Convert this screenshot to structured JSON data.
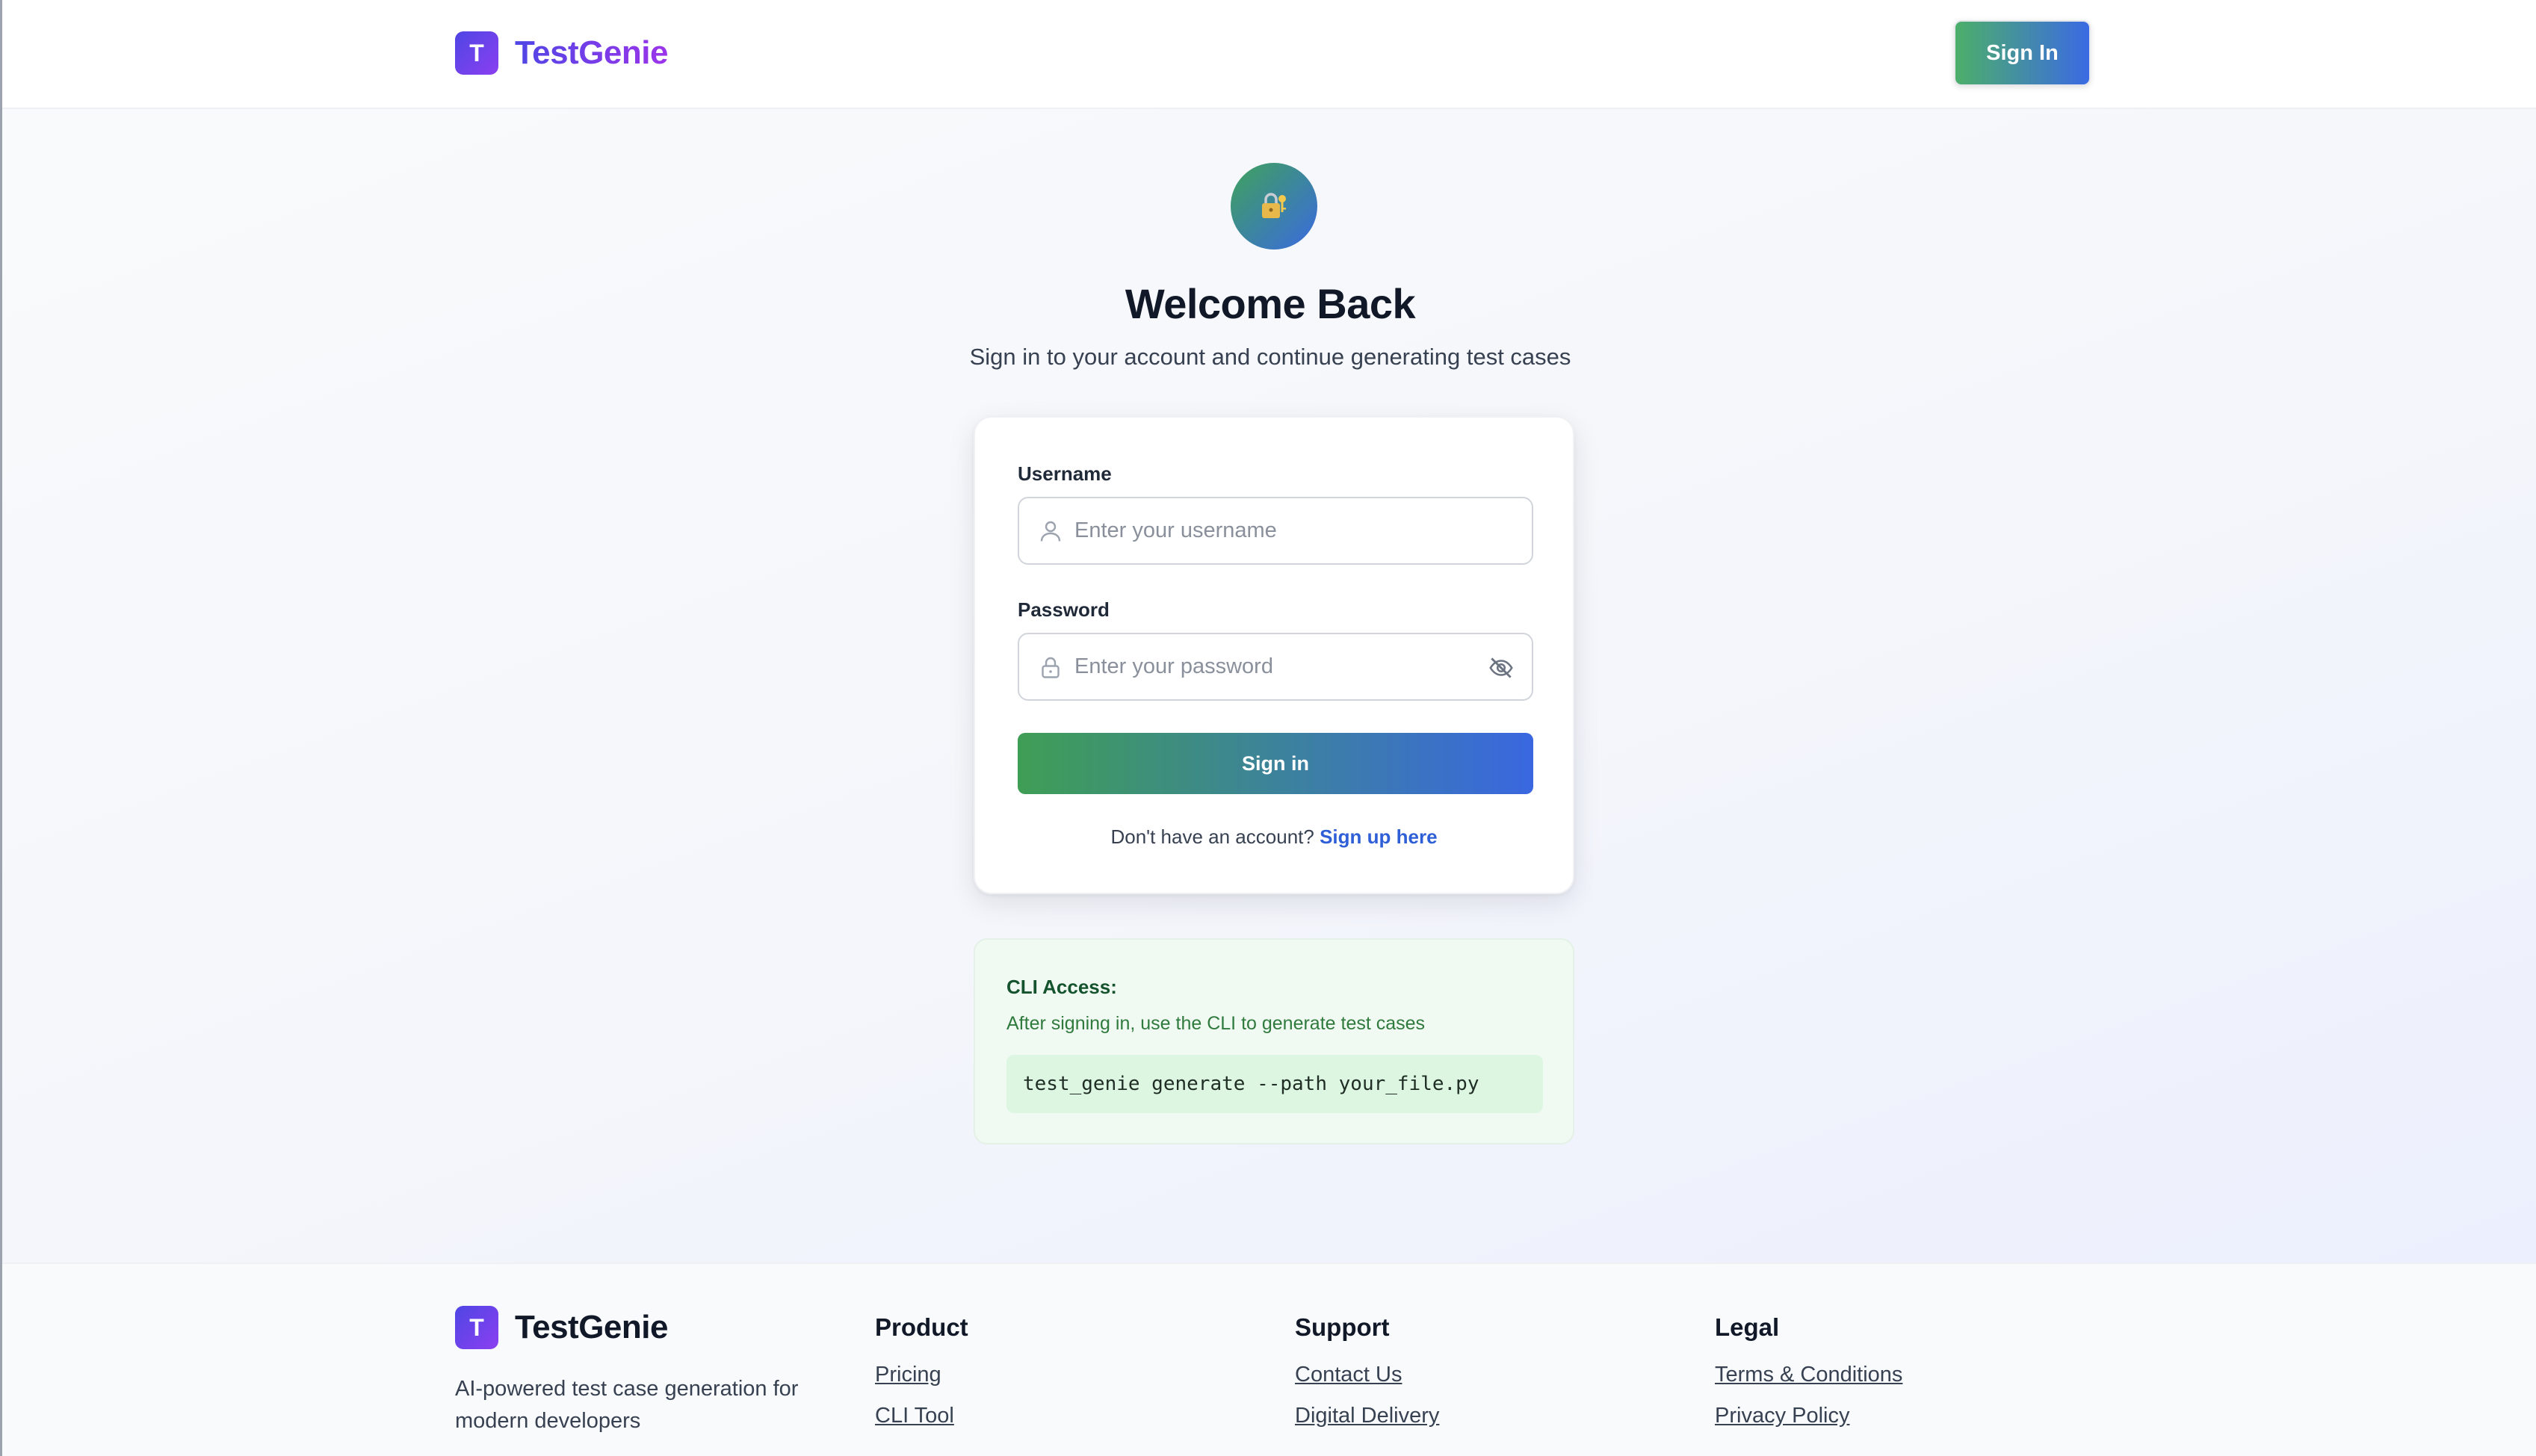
{
  "header": {
    "logo_letter": "T",
    "brand": "TestGenie",
    "signin_label": "Sign In"
  },
  "login": {
    "lock_icon": "lock-key-icon",
    "title": "Welcome Back",
    "subtitle": "Sign in to your account and continue generating test cases",
    "username_label": "Username",
    "username_placeholder": "Enter your username",
    "password_label": "Password",
    "password_placeholder": "Enter your password",
    "submit_label": "Sign in",
    "signup_prompt": "Don't have an account?",
    "signup_link": "Sign up here"
  },
  "cli": {
    "title": "CLI Access:",
    "description": "After signing in, use the CLI to generate test cases",
    "command": "test_genie generate --path your_file.py"
  },
  "footer": {
    "logo_letter": "T",
    "brand": "TestGenie",
    "tagline": "AI-powered test case generation for modern developers",
    "columns": [
      {
        "title": "Product",
        "links": [
          "Pricing",
          "CLI Tool"
        ]
      },
      {
        "title": "Support",
        "links": [
          "Contact Us",
          "Digital Delivery"
        ]
      },
      {
        "title": "Legal",
        "links": [
          "Terms & Conditions",
          "Privacy Policy"
        ]
      }
    ]
  },
  "colors": {
    "brand_gradient_start": "#4f46e5",
    "brand_gradient_end": "#9b34ea",
    "button_gradient_start": "#3f9e55",
    "button_gradient_end": "#3a67e0",
    "link": "#2f5fd6"
  }
}
